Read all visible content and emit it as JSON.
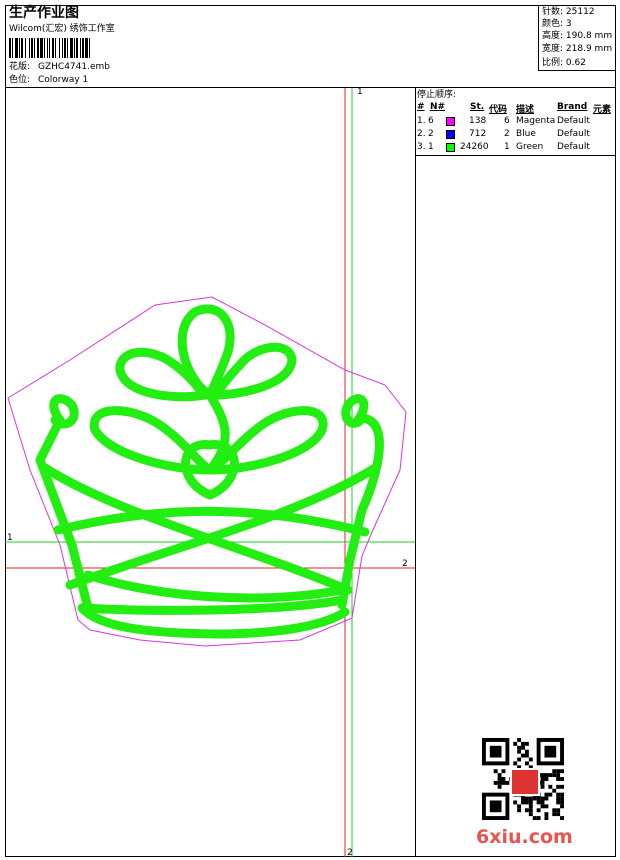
{
  "header": {
    "title": "生产作业图",
    "studio": "Wilcom(汇宏) 绣饰工作室",
    "file_label": "花版:",
    "file_value": "GZHC4741.emb",
    "colorway_label": "色位:",
    "colorway_value": "Colorway 1"
  },
  "stats": [
    {
      "label": "针数:",
      "value": "25112"
    },
    {
      "label": "颜色:",
      "value": "3"
    },
    {
      "label": "高度:",
      "value": "190.8 mm"
    },
    {
      "label": "宽度:",
      "value": "218.9 mm"
    },
    {
      "label": "比例:",
      "value": "0.62"
    }
  ],
  "stop_sequence": {
    "title": "停止顺序:",
    "headers": [
      "#",
      "N#",
      "St.",
      "代码",
      "描述",
      "Brand",
      "元素"
    ],
    "rows": [
      {
        "index": "1.",
        "n": "6",
        "color": "#ff00ff",
        "stitches": "138",
        "code": "6",
        "desc": "Magenta",
        "brand": "Default"
      },
      {
        "index": "2.",
        "n": "2",
        "color": "#0000ff",
        "stitches": "712",
        "code": "2",
        "desc": "Blue",
        "brand": "Default"
      },
      {
        "index": "3.",
        "n": "1",
        "color": "#00ff00",
        "stitches": "24260",
        "code": "1",
        "desc": "Green",
        "brand": "Default"
      }
    ]
  },
  "guides": {
    "v1_label": "1",
    "v2_label": "2",
    "h1_label": "1",
    "h2_label": "2"
  },
  "watermark": "6xiu.com",
  "colors": {
    "outline": "#dd33dd",
    "stitch": "#22ee11",
    "guide_red": "#ee2222",
    "guide_green": "#22cc22",
    "brand": "#e8554e"
  }
}
